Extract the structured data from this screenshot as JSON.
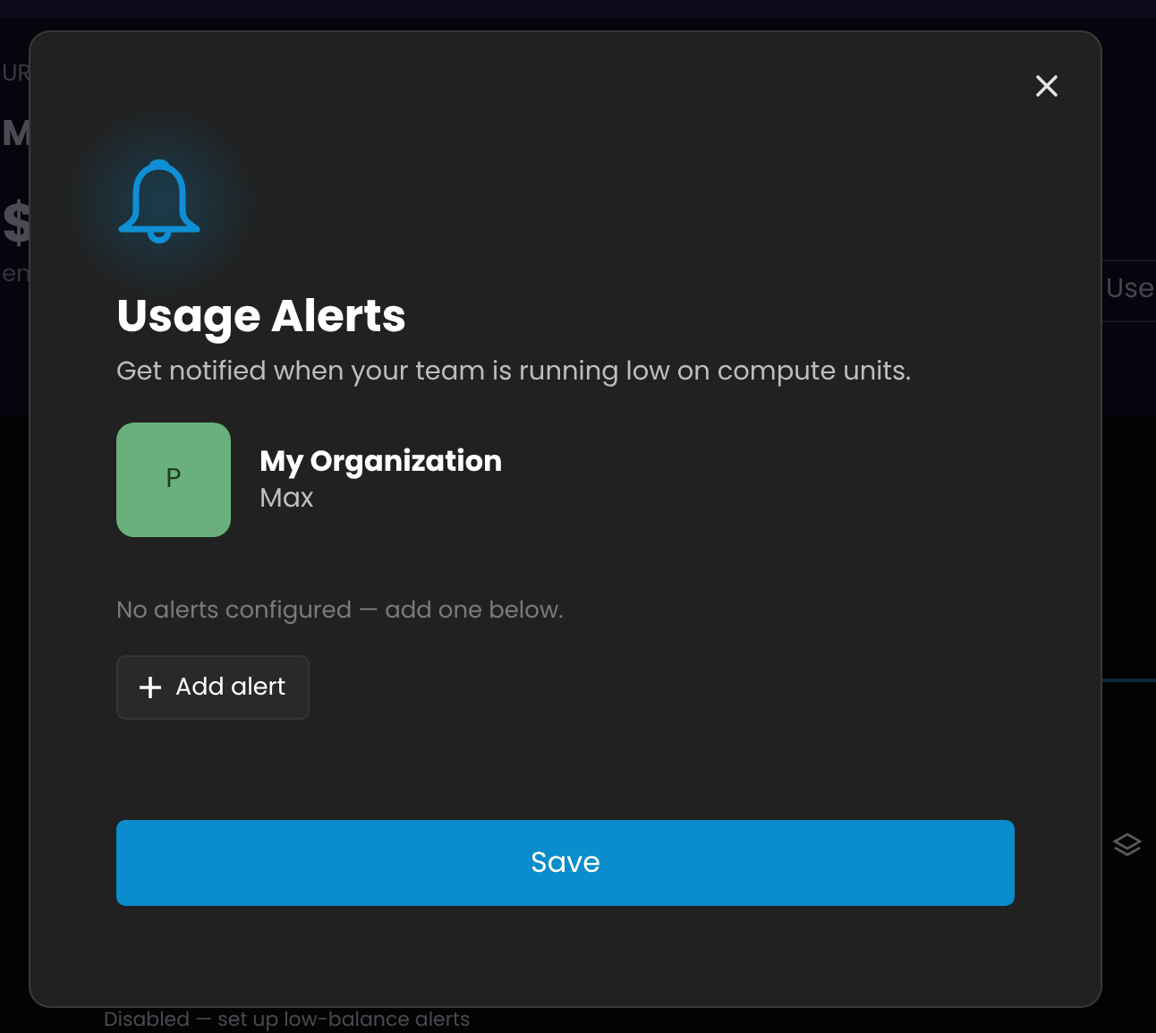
{
  "background": {
    "left_texts": [
      "UR",
      "M",
      "$",
      "en"
    ],
    "right_text": "Use",
    "bottom_text": "Disabled — set up low-balance alerts"
  },
  "dialog": {
    "title": "Usage Alerts",
    "description": "Get notified when your team is running low on compute units.",
    "organization": {
      "initial": "P",
      "name": "My Organization",
      "member": "Max",
      "color": "#69b07c"
    },
    "empty_message": "No alerts configured — add one below.",
    "add_button": "Add alert",
    "save_button": "Save"
  }
}
